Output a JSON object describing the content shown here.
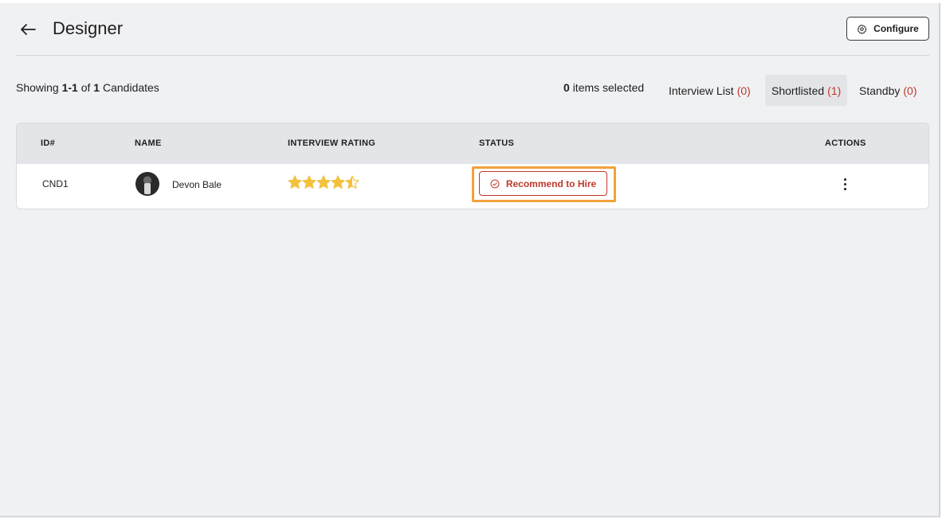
{
  "header": {
    "title": "Designer",
    "configure_label": "Configure"
  },
  "toolbar": {
    "showing_prefix": "Showing",
    "showing_range": "1-1",
    "showing_of": "of",
    "showing_total": "1",
    "showing_suffix": "Candidates",
    "selected_count": "0",
    "selected_label": "items selected",
    "tabs": [
      {
        "label": "Interview List",
        "count": "(0)",
        "active": false
      },
      {
        "label": "Shortlisted",
        "count": "(1)",
        "active": true
      },
      {
        "label": "Standby",
        "count": "(0)",
        "active": false
      }
    ]
  },
  "table": {
    "columns": [
      "ID#",
      "NAME",
      "INTERVIEW RATING",
      "STATUS",
      "ACTIONS"
    ],
    "rows": [
      {
        "id": "CND1",
        "name": "Devon Bale",
        "rating": 4.5,
        "status": "Recommend to Hire"
      }
    ]
  },
  "colors": {
    "accent_red": "#c0392b",
    "highlight_orange": "#f2a13a",
    "star_gold": "#f2c23d"
  },
  "icons": {
    "back": "arrow-left-icon",
    "configure": "gear-icon",
    "status": "check-circle-icon",
    "actions": "more-vertical-icon"
  }
}
